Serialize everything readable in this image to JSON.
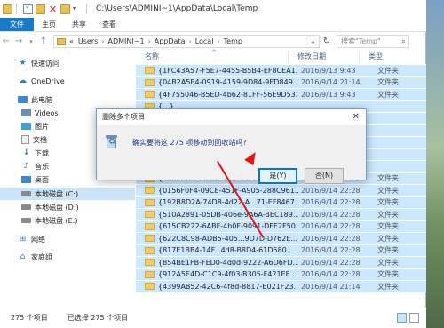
{
  "title_bar": {
    "path": "C:\\Users\\ADMINI~1\\AppData\\Local\\Temp"
  },
  "ribbon": {
    "tabs": [
      "文件",
      "主页",
      "共享",
      "查看"
    ]
  },
  "address": {
    "crumbs": [
      "«",
      "Users",
      "ADMINI~1",
      "AppData",
      "Local",
      "Temp"
    ],
    "search_placeholder": "搜索\"Temp\""
  },
  "nav": {
    "items": [
      {
        "label": "快速访问",
        "icon": "star-icon"
      },
      {
        "label": "OneDrive",
        "icon": "cloud-icon"
      },
      {
        "label": "此电脑",
        "icon": "pc-icon"
      },
      {
        "label": "Videos",
        "icon": "video-icon"
      },
      {
        "label": "图片",
        "icon": "picture-icon"
      },
      {
        "label": "文档",
        "icon": "document-icon"
      },
      {
        "label": "下载",
        "icon": "download-icon"
      },
      {
        "label": "音乐",
        "icon": "music-icon"
      },
      {
        "label": "桌面",
        "icon": "desktop-icon"
      },
      {
        "label": "本地磁盘 (C:)",
        "icon": "drive-icon"
      },
      {
        "label": "本地磁盘 (D:)",
        "icon": "drive-icon"
      },
      {
        "label": "本地磁盘 (E:)",
        "icon": "drive-icon"
      },
      {
        "label": "网络",
        "icon": "network-icon"
      },
      {
        "label": "家庭组",
        "icon": "homegroup-icon"
      }
    ]
  },
  "columns": {
    "name": "名称",
    "date": "修改日期",
    "type": "类型"
  },
  "files": [
    {
      "name": "{1FC43A57-F5E7-4455-B5B4-EF8CEA1...",
      "date": "2016/9/13 9:43",
      "type": "文件夹"
    },
    {
      "name": "{04B2A5E4-0919-4159-9D84-9ED849...",
      "date": "2016/9/14 21:14",
      "type": "文件夹"
    },
    {
      "name": "{4F755046-B5ED-4b62-81FF-56E9D53...",
      "date": "2016/9/13 9:43",
      "type": "文件夹"
    },
    {
      "name": "{...}",
      "date": "",
      "type": ""
    },
    {
      "name": "{...}",
      "date": "",
      "type": ""
    },
    {
      "name": "{...}",
      "date": "",
      "type": ""
    },
    {
      "name": "{...}",
      "date": "",
      "type": ""
    },
    {
      "name": "{...}",
      "date": "",
      "type": ""
    },
    {
      "name": "{...}",
      "date": "",
      "type": ""
    },
    {
      "name": "{81B9A8F8-4802-4e29-A8E1-...8D9515...",
      "date": "2016/9/14 22:28",
      "type": "文件夹"
    },
    {
      "name": "{0156F0F4-09CE-451F-A905-288C961...",
      "date": "2016/9/14 22:28",
      "type": "文件夹"
    },
    {
      "name": "{192B8D2A-74D8-4d22-A...71-EF8467...",
      "date": "2016/9/14 22:28",
      "type": "文件夹"
    },
    {
      "name": "{510A2891-05DB-406e-9A6A-BEC189...",
      "date": "2016/9/14 22:28",
      "type": "文件夹"
    },
    {
      "name": "{615CB222-6ABF-4b0F-9091-DFE2F50...",
      "date": "2016/9/14 22:28",
      "type": "文件夹"
    },
    {
      "name": "{622C8C98-ADB5-405...9D7D-D762E...",
      "date": "2016/9/14 22:28",
      "type": "文件夹"
    },
    {
      "name": "{817E1BB4-14F...4d8-B8D4-61D580...",
      "date": "2016/9/14 22:28",
      "type": "文件夹"
    },
    {
      "name": "{854BE1FB-FED0-4d0d-9222-A6D6FD...",
      "date": "2016/9/14 22:28",
      "type": "文件夹"
    },
    {
      "name": "{912A5E4D-C1C9-4f03-B305-F421EE...",
      "date": "2016/9/14 22:28",
      "type": "文件夹"
    },
    {
      "name": "{4399AB52-42C6-4f8d-8817-E021F23...",
      "date": "2016/9/14 21:14",
      "type": "文件夹"
    }
  ],
  "status": {
    "count": "275 个项目",
    "selected": "已选择 275 个项目"
  },
  "dialog": {
    "title": "删除多个项目",
    "message": "确实要将这 275 项移动到回收站吗?",
    "yes": "是(Y)",
    "no": "否(N)",
    "close": "✕"
  },
  "accent_color": "#1979ca"
}
